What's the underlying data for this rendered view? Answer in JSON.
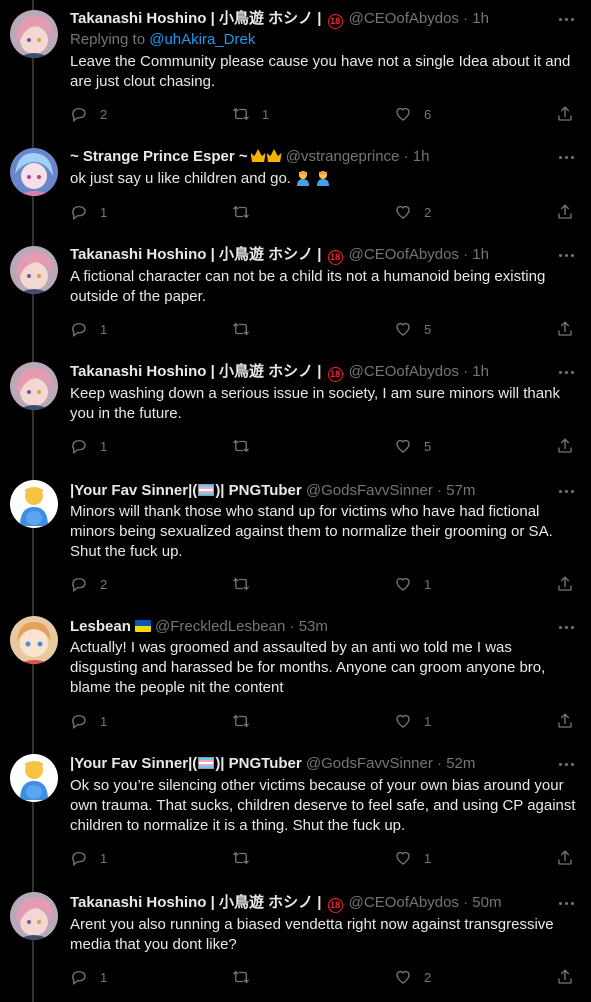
{
  "tweets": [
    {
      "name": "Takanashi Hoshino | 小鳥遊 ホシノ |",
      "badge": "18",
      "handle": "@CEOofAbydos",
      "time": "1h",
      "replying_prefix": "Replying to",
      "replying_to": "@uhAkira_Drek",
      "text": "Leave the Community please cause you have not a single Idea about it and are just clout chasing.",
      "replies": "2",
      "retweets": "1",
      "likes": "6"
    },
    {
      "name": "~ Strange Prince Esper ~",
      "handle": "@vstrangeprince",
      "time": "1h",
      "text": "ok just say u like children and go.",
      "replies": "1",
      "retweets": "",
      "likes": "2"
    },
    {
      "name": "Takanashi Hoshino | 小鳥遊 ホシノ |",
      "badge": "18",
      "handle": "@CEOofAbydos",
      "time": "1h",
      "text": "A fictional character can not be a child its not a humanoid being existing outside of the paper.",
      "replies": "1",
      "retweets": "",
      "likes": "5"
    },
    {
      "name": "Takanashi Hoshino | 小鳥遊 ホシノ |",
      "badge": "18",
      "handle": "@CEOofAbydos",
      "time": "1h",
      "text": "Keep washing down a serious issue in society, I am sure minors will thank you in the future.",
      "replies": "1",
      "retweets": "",
      "likes": "5"
    },
    {
      "name_pre": "|Your Fav Sinner|(",
      "name_post": ")| PNGTuber",
      "handle": "@GodsFavvSinner",
      "time": "57m",
      "text": "Minors will thank those who stand up for victims who have had fictional minors being sexualized against them to normalize their grooming or SA. Shut the fuck up.",
      "replies": "2",
      "retweets": "",
      "likes": "1"
    },
    {
      "name": "Lesbean",
      "handle": "@FreckledLesbean",
      "time": "53m",
      "text": "Actually! I was groomed and assaulted by an anti wo told me I was disgusting and harassed be for months. Anyone can groom anyone bro, blame the people nit the content",
      "replies": "1",
      "retweets": "",
      "likes": "1"
    },
    {
      "name_pre": "|Your Fav Sinner|(",
      "name_post": ")| PNGTuber",
      "handle": "@GodsFavvSinner",
      "time": "52m",
      "text": "Ok so you’re silencing other victims because of your own bias around your own trauma. That sucks, children deserve to feel safe, and using CP against children to normalize it is a thing. Shut the fuck up.",
      "replies": "1",
      "retweets": "",
      "likes": "1"
    },
    {
      "name": "Takanashi Hoshino | 小鳥遊 ホシノ |",
      "badge": "18",
      "handle": "@CEOofAbydos",
      "time": "50m",
      "text": "Arent you also running a biased vendetta right now against transgressive media that you dont like?",
      "replies": "1",
      "retweets": "",
      "likes": "2"
    }
  ],
  "separator": "·",
  "icons": {
    "reply": "reply-icon",
    "retweet": "retweet-icon",
    "like": "heart-icon",
    "share": "share-icon",
    "more": "more-icon",
    "crown": "crown-emoji",
    "person": "person-emoji",
    "flag_ua": "ukraine-flag-emoji",
    "flag_trans": "trans-flag-emoji"
  },
  "colors": {
    "background": "#000000",
    "muted": "#71767b",
    "text": "#e7e9ea",
    "link": "#1d9bf0",
    "badge": "#f4212e"
  }
}
